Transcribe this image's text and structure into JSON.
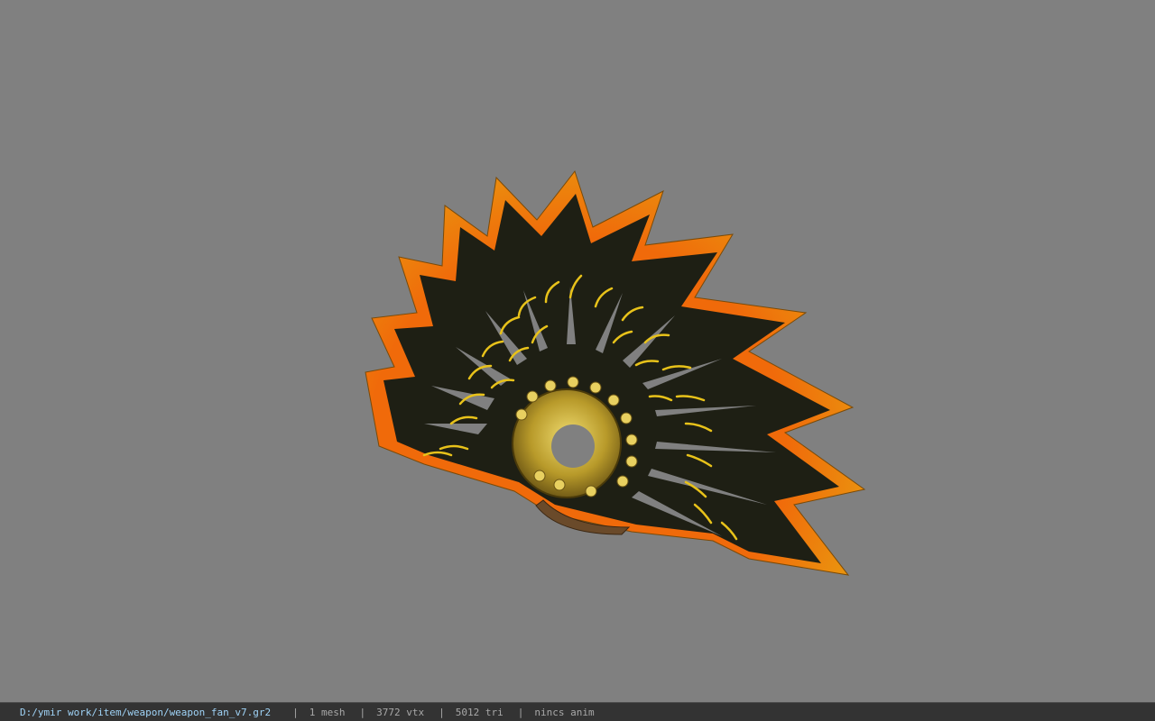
{
  "viewer": {
    "background_color": "#808080",
    "model": "weapon_fan_v7",
    "model_colors": {
      "outer_edge": "#e8a010",
      "inner_edge": "#f06a0a",
      "feather_body": "#1e1f14",
      "feather_pattern": "#e8c21a",
      "hub": "#b89a2a"
    }
  },
  "status_bar": {
    "file_path": "D:/ymir work/item/weapon/weapon_fan_v7.gr2",
    "separator": "|",
    "mesh_count": "1 mesh",
    "vertex_count": "3772 vtx",
    "triangle_count": "5012 tri",
    "animation": "nincs anim"
  }
}
